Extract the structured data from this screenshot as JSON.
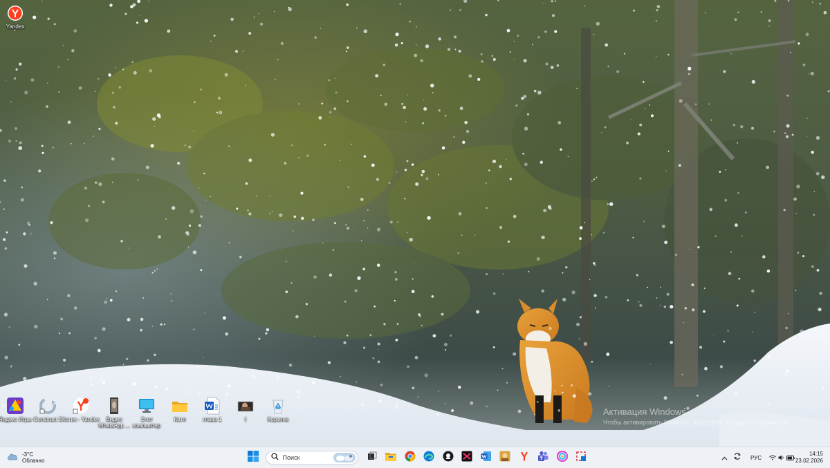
{
  "desktop": {
    "top_icon": {
      "label": "Yandex",
      "icon": "yandex-browser-icon"
    },
    "icons": [
      {
        "label": "Яндекс Игры",
        "icon": "yandex-games-icon"
      },
      {
        "label": "Construct 3",
        "icon": "construct-3-icon"
      },
      {
        "label": "Котик - Yandex",
        "icon": "yandex-browser-icon"
      },
      {
        "label": "Видео WhatsApp ...",
        "icon": "video-file-icon"
      },
      {
        "label": "Этот компьютер",
        "icon": "this-pc-icon"
      },
      {
        "label": "Катя",
        "icon": "folder-icon"
      },
      {
        "label": "глава 1",
        "icon": "word-document-icon"
      },
      {
        "label": "I",
        "icon": "image-file-icon"
      },
      {
        "label": "Корзина",
        "icon": "recycle-bin-icon"
      }
    ],
    "watermark": {
      "title": "Активация Windows",
      "subtitle": "Чтобы активировать Windows, перейдите в раздел \"Параметры\"."
    }
  },
  "taskbar": {
    "weather": {
      "temp": "-3°C",
      "condition": "Облачно",
      "icon": "cloud-icon"
    },
    "start_icon": "windows-start-icon",
    "search": {
      "placeholder": "Поиск",
      "icon": "search-icon"
    },
    "apps": [
      "task-view-icon",
      "file-explorer-icon",
      "chrome-icon",
      "edge-icon",
      "app-icon",
      "capcut-icon",
      "word-icon",
      "photos-icon",
      "yandex-browser-icon",
      "teams-icon",
      "app-icon",
      "snipping-tool-icon"
    ],
    "tray": {
      "language": "РУС",
      "time": "14:15",
      "date": "23.02.2026",
      "icons": [
        "chevron-up-icon",
        "sync-icon",
        "wifi-icon",
        "speaker-icon",
        "battery-icon"
      ]
    }
  },
  "colors": {
    "taskbar_bg": "#eef1f6",
    "accent": "#0067c0"
  }
}
